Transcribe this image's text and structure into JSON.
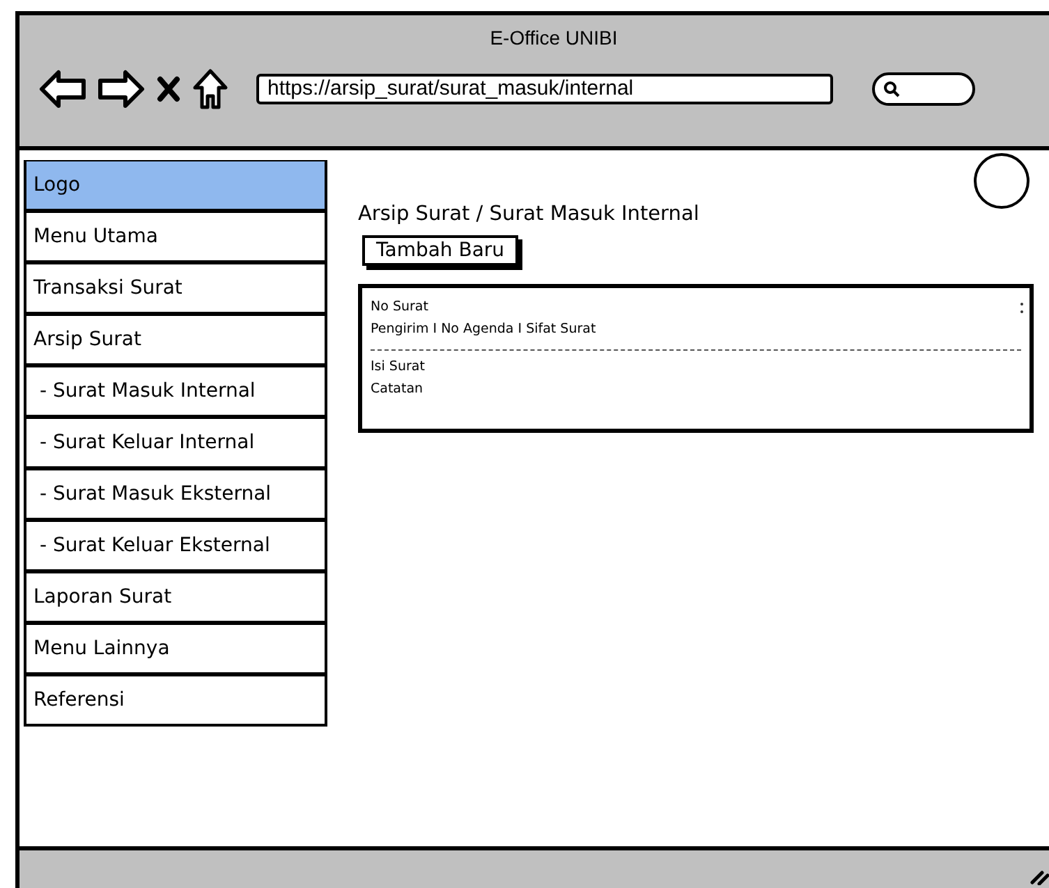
{
  "window": {
    "title": "E-Office UNIBI"
  },
  "browser": {
    "url": "https://arsip_surat/surat_masuk/internal"
  },
  "sidebar": {
    "items": [
      {
        "label": "Logo",
        "selected": true
      },
      {
        "label": "Menu Utama",
        "selected": false
      },
      {
        "label": "Transaksi Surat",
        "selected": false
      },
      {
        "label": "Arsip Surat",
        "selected": false
      },
      {
        "label": " - Surat Masuk Internal",
        "selected": false
      },
      {
        "label": " - Surat Keluar Internal",
        "selected": false
      },
      {
        "label": " - Surat Masuk Eksternal",
        "selected": false
      },
      {
        "label": " - Surat Keluar Eksternal",
        "selected": false
      },
      {
        "label": "Laporan Surat",
        "selected": false
      },
      {
        "label": "Menu Lainnya",
        "selected": false
      },
      {
        "label": "Referensi",
        "selected": false
      }
    ]
  },
  "main": {
    "breadcrumb": "Arsip Surat / Surat Masuk Internal",
    "add_button": "Tambah Baru",
    "card": {
      "title": "No Surat",
      "meta": "Pengirim I No Agenda I Sifat Surat",
      "lines": [
        "Isi Surat",
        "Catatan"
      ]
    }
  }
}
